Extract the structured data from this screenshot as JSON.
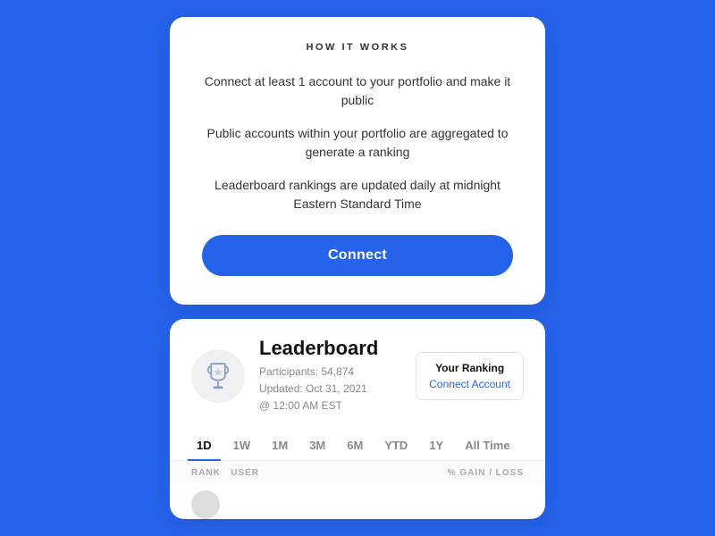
{
  "howItWorks": {
    "title": "HOW IT WORKS",
    "step1": "Connect at least 1 account to your portfolio and make it public",
    "step2": "Public accounts within your portfolio are aggregated to generate a ranking",
    "step3": "Leaderboard rankings are updated daily at midnight Eastern Standard Time",
    "connectButton": "Connect"
  },
  "leaderboard": {
    "title": "Leaderboard",
    "participants": "Participants: 54,874",
    "updated": "Updated: Oct 31, 2021",
    "time": "@ 12:00 AM EST",
    "rankingLabel": "Your Ranking",
    "connectAccountLabel": "Connect Account",
    "tabs": [
      {
        "id": "1d",
        "label": "1D",
        "active": true
      },
      {
        "id": "1w",
        "label": "1W",
        "active": false
      },
      {
        "id": "1m",
        "label": "1M",
        "active": false
      },
      {
        "id": "3m",
        "label": "3M",
        "active": false
      },
      {
        "id": "6m",
        "label": "6M",
        "active": false
      },
      {
        "id": "ytd",
        "label": "YTD",
        "active": false
      },
      {
        "id": "1y",
        "label": "1Y",
        "active": false
      },
      {
        "id": "alltime",
        "label": "All Time",
        "active": false
      }
    ],
    "tableHeaders": {
      "left": "RANK  USER",
      "right": "% GAIN / LOSS"
    }
  }
}
